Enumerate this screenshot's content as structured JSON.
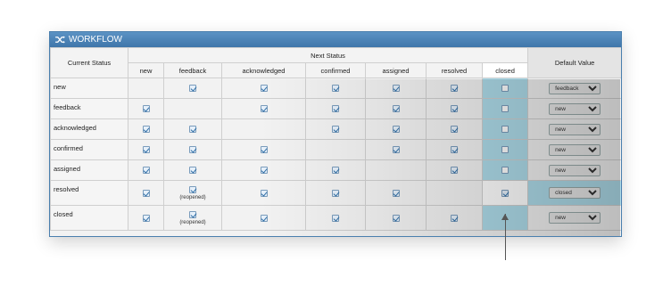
{
  "title": "WORKFLOW",
  "header": {
    "current_status": "Current Status",
    "next_status": "Next Status",
    "default_value": "Default Value",
    "columns": [
      "new",
      "feedback",
      "acknowledged",
      "confirmed",
      "assigned",
      "resolved",
      "closed"
    ]
  },
  "rows": [
    {
      "label": "new",
      "checks": [
        null,
        true,
        true,
        true,
        true,
        true,
        false
      ],
      "notes": [],
      "default": "feedback"
    },
    {
      "label": "feedback",
      "checks": [
        true,
        null,
        true,
        true,
        true,
        true,
        false
      ],
      "notes": [],
      "default": "new"
    },
    {
      "label": "acknowledged",
      "checks": [
        true,
        true,
        null,
        true,
        true,
        true,
        false
      ],
      "notes": [],
      "default": "new"
    },
    {
      "label": "confirmed",
      "checks": [
        true,
        true,
        true,
        null,
        true,
        true,
        false
      ],
      "notes": [],
      "default": "new"
    },
    {
      "label": "assigned",
      "checks": [
        true,
        true,
        true,
        true,
        null,
        true,
        false
      ],
      "notes": [],
      "default": "new"
    },
    {
      "label": "resolved",
      "checks": [
        true,
        true,
        true,
        true,
        true,
        null,
        true
      ],
      "notes": [
        null,
        "(reopened)",
        null,
        null,
        null,
        null,
        null
      ],
      "default": "closed"
    },
    {
      "label": "closed",
      "checks": [
        true,
        true,
        true,
        true,
        true,
        true,
        null
      ],
      "notes": [
        null,
        "(reopened)",
        null,
        null,
        null,
        null,
        null
      ],
      "default": "new"
    }
  ],
  "colors": {
    "accent": "#4a7fae",
    "highlight": "#aedcea"
  }
}
